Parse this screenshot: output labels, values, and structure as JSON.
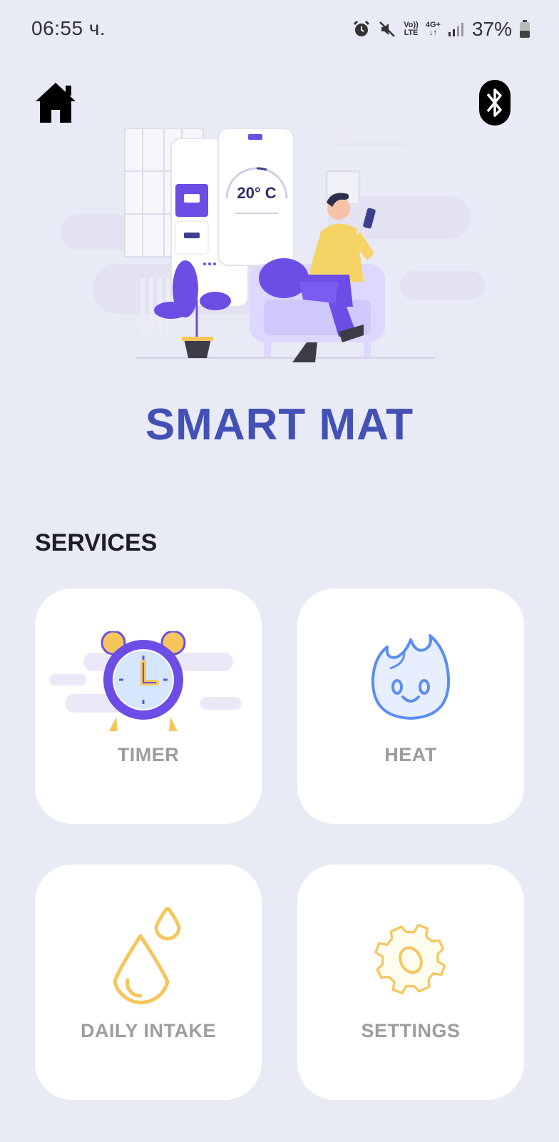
{
  "status_bar": {
    "time": "06:55 ч.",
    "volte_line1": "Vo))",
    "volte_line2": "LTE",
    "network": "4G+",
    "battery": "37%"
  },
  "header": {
    "home_icon": "home-icon",
    "bluetooth_icon": "bluetooth-icon"
  },
  "hero": {
    "temperature": "20° C"
  },
  "app_title": "SMART MAT",
  "services": {
    "title": "SERVICES",
    "items": [
      {
        "label": "TIMER",
        "icon": "alarm-clock-icon"
      },
      {
        "label": "HEAT",
        "icon": "flame-icon"
      },
      {
        "label": "DAILY INTAKE",
        "icon": "water-drop-icon"
      },
      {
        "label": "SETTINGS",
        "icon": "gear-icon"
      }
    ]
  },
  "colors": {
    "background": "#e8eaf6",
    "title": "#4350b5",
    "accent_purple": "#6c4de6",
    "accent_yellow": "#f5c65a",
    "heat_blue": "#5b8ef2",
    "card_label": "#9d9d9d"
  }
}
